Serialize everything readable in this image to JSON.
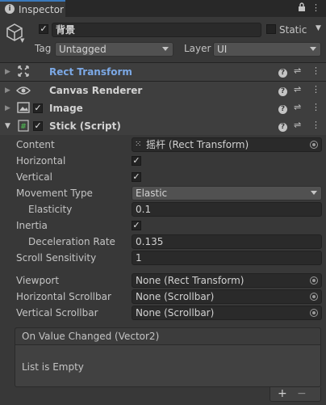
{
  "tab": {
    "title": "Inspector"
  },
  "header": {
    "name_value": "背景",
    "static_label": "Static",
    "tag_label": "Tag",
    "tag_value": "Untagged",
    "layer_label": "Layer",
    "layer_value": "UI"
  },
  "components": [
    {
      "title": "Rect Transform",
      "color": "#7ca9e6"
    },
    {
      "title": "Canvas Renderer",
      "color": "#d2d2d2"
    },
    {
      "title": "Image",
      "color": "#d2d2d2"
    },
    {
      "title": "Stick (Script)",
      "color": "#d2d2d2"
    }
  ],
  "stick": {
    "content_label": "Content",
    "content_value": "摇杆 (Rect Transform)",
    "horizontal_label": "Horizontal",
    "vertical_label": "Vertical",
    "movement_type_label": "Movement Type",
    "movement_type_value": "Elastic",
    "elasticity_label": "Elasticity",
    "elasticity_value": "0.1",
    "inertia_label": "Inertia",
    "deceleration_label": "Deceleration Rate",
    "deceleration_value": "0.135",
    "scroll_sensitivity_label": "Scroll Sensitivity",
    "scroll_sensitivity_value": "1",
    "viewport_label": "Viewport",
    "viewport_value": "None (Rect Transform)",
    "hscroll_label": "Horizontal Scrollbar",
    "hscroll_value": "None (Scrollbar)",
    "vscroll_label": "Vertical Scrollbar",
    "vscroll_value": "None (Scrollbar)"
  },
  "event": {
    "title": "On Value Changed (Vector2)",
    "empty_text": "List is Empty",
    "add": "+",
    "remove": "−"
  }
}
